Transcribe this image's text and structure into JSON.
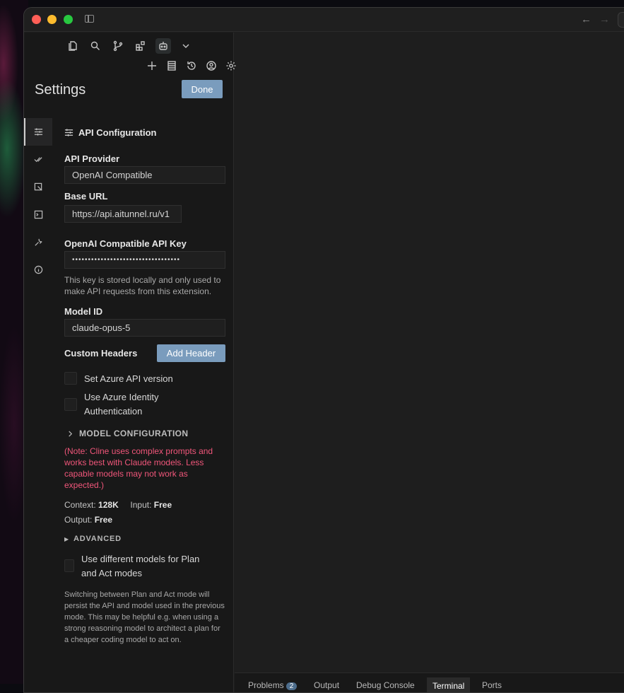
{
  "window": {
    "nav_back": "←",
    "nav_forward": "→"
  },
  "toolbar": {
    "row1": [
      "files-icon",
      "search-icon",
      "source-control-icon",
      "extensions-icon",
      "cline-robot-icon",
      "chevron-down-icon"
    ],
    "row2": [
      "plus-icon",
      "mcp-servers-icon",
      "history-icon",
      "account-icon",
      "gear-icon"
    ],
    "plus": "+",
    "chevron": "⌄"
  },
  "settings": {
    "title": "Settings",
    "done_label": "Done"
  },
  "rail": {
    "items": [
      "api-config",
      "features",
      "browser",
      "terminal",
      "debug",
      "about"
    ]
  },
  "api": {
    "section_title": "API Configuration",
    "provider_label": "API Provider",
    "provider_value": "OpenAI Compatible",
    "base_url_label": "Base URL",
    "base_url_value": "https://api.aitunnel.ru/v1",
    "api_key_label": "OpenAI Compatible API Key",
    "api_key_value": "••••••••••••••••••••••••••••••••••",
    "api_key_help": "This key is stored locally and only used to make API requests from this extension.",
    "model_id_label": "Model ID",
    "model_id_value": "claude-opus-5",
    "custom_headers_label": "Custom Headers",
    "add_header_label": "Add Header",
    "azure_version_label": "Set Azure API version",
    "azure_identity_label": "Use Azure Identity Authentication",
    "model_config_label": "MODEL CONFIGURATION",
    "note": "(Note: Cline uses complex prompts and works best with Claude models. Less capable models may not work as expected.)",
    "context_label": "Context:",
    "context_value": "128K",
    "input_label": "Input:",
    "input_value": "Free",
    "output_label": "Output:",
    "output_value": "Free",
    "advanced_label": "ADVANCED",
    "plan_act_label": "Use different models for Plan and Act modes",
    "plan_act_help": "Switching between Plan and Act mode will persist the API and model used in the previous mode. This may be helpful e.g. when using a strong reasoning model to architect a plan for a cheaper coding model to act on."
  },
  "bottom_tabs": {
    "problems": "Problems",
    "problems_count": "2",
    "output": "Output",
    "debug_console": "Debug Console",
    "terminal": "Terminal",
    "ports": "Ports"
  }
}
